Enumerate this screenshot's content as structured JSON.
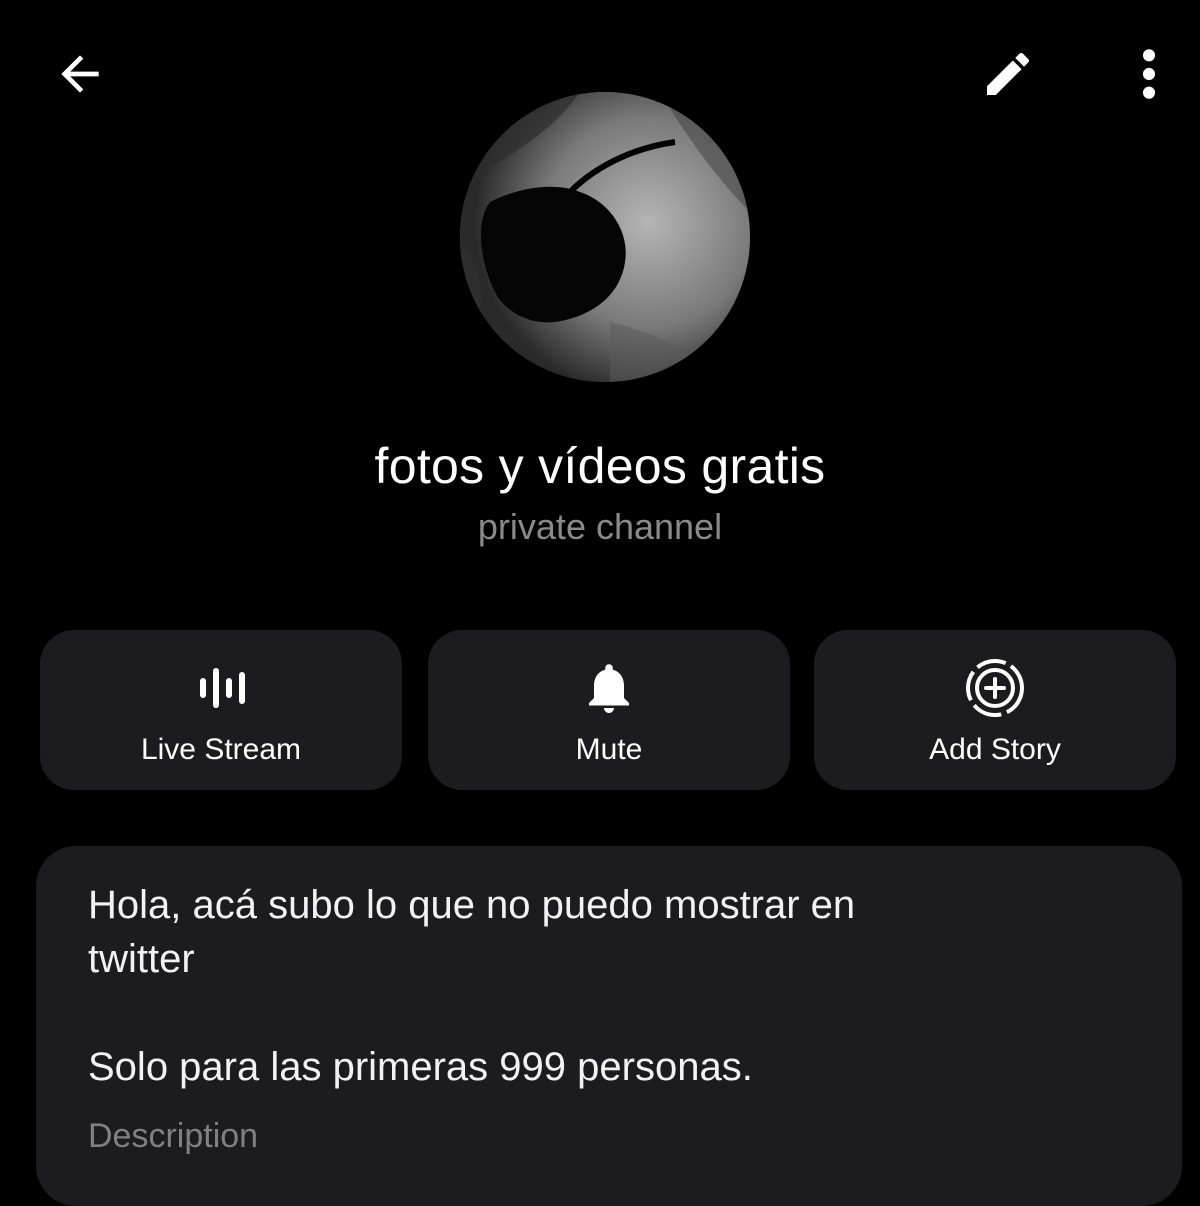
{
  "header": {
    "back_icon": "arrow-left-icon",
    "edit_icon": "pencil-icon",
    "more_icon": "more-vertical-icon"
  },
  "profile": {
    "title": "fotos y vídeos gratis",
    "subtitle": "private channel"
  },
  "actions": [
    {
      "label": "Live Stream",
      "icon": "live-stream-icon"
    },
    {
      "label": "Mute",
      "icon": "bell-icon"
    },
    {
      "label": "Add Story",
      "icon": "add-story-icon"
    }
  ],
  "description": {
    "line1": "Hola, acá subo lo que no puedo mostrar en",
    "line2": "twitter",
    "line3": "Solo para las primeras 999 personas.",
    "label": "Description"
  },
  "colors": {
    "background": "#000000",
    "card": "#1c1c1e",
    "text": "#ffffff",
    "secondary_text": "#8a8a8a"
  }
}
